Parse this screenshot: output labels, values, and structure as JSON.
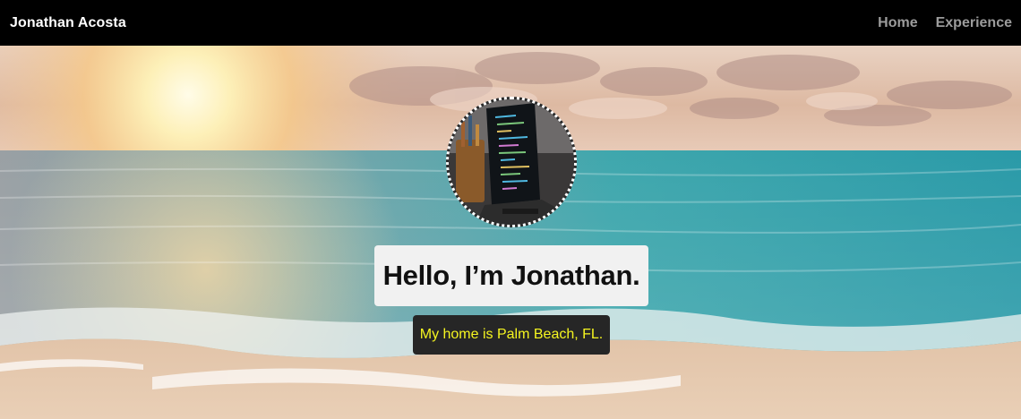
{
  "navbar": {
    "brand": "Jonathan Acosta",
    "links": [
      "Home",
      "Experience"
    ]
  },
  "hero": {
    "headline": "Hello, I’m Jonathan.",
    "subline": "My home is Palm Beach, FL.",
    "avatar_icon": "profile-photo-laptop-code",
    "colors": {
      "headline_box": "#f1f1f1",
      "subline_box": "#262626",
      "subline_text": "#f5f520",
      "nav_link": "#9c9c9c"
    }
  }
}
